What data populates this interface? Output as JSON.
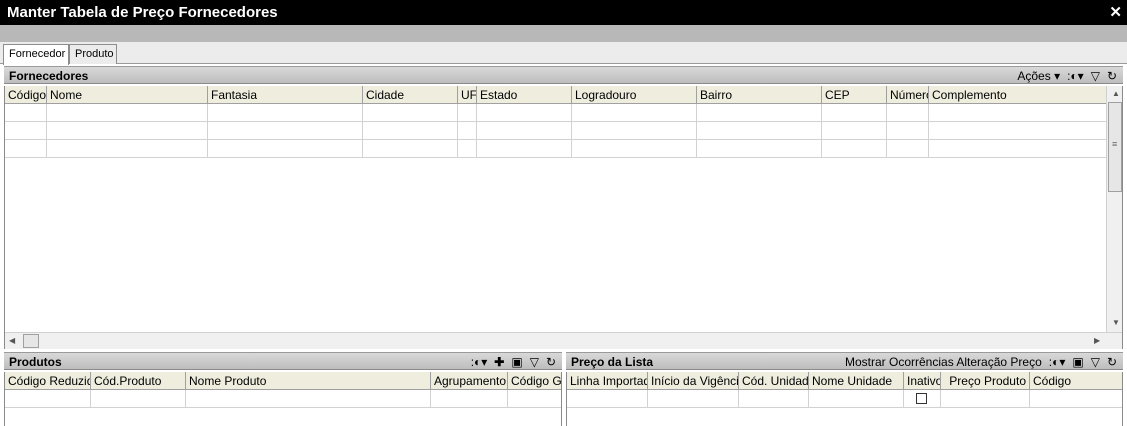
{
  "window": {
    "title": "Manter Tabela de Preço Fornecedores",
    "close_glyph": "✕"
  },
  "tabs": [
    {
      "label": "Fornecedor",
      "active": true
    },
    {
      "label": "Produto",
      "active": false
    }
  ],
  "fornecedores": {
    "title": "Fornecedores",
    "actions_label": "Ações",
    "icons": [
      "dropdown-icon",
      "view-options-icon",
      "filter-icon",
      "refresh-icon"
    ],
    "columns": [
      "Código",
      "Nome",
      "Fantasia",
      "Cidade",
      "UF",
      "Estado",
      "Logradouro",
      "Bairro",
      "CEP",
      "Número",
      "Complemento"
    ]
  },
  "produtos": {
    "title": "Produtos",
    "icons": [
      "view-options-icon",
      "add-icon",
      "export-icon",
      "filter-icon",
      "refresh-icon"
    ],
    "columns": [
      "Código Reduzido",
      "Cód.Produto",
      "Nome Produto",
      "Agrupamento",
      "Código Gru"
    ]
  },
  "preco_lista": {
    "title": "Preço da Lista",
    "show_occurrences_label": "Mostrar Ocorrências Alteração Preço",
    "icons": [
      "view-options-icon",
      "export-icon",
      "filter-icon",
      "refresh-icon"
    ],
    "columns": [
      "Linha Importada",
      "Início da Vigência",
      "Cód. Unidade",
      "Nome Unidade",
      "Inativo",
      "Preço Produto",
      "Código"
    ]
  },
  "colors": {
    "titlebar": "#000000",
    "header_bg": "#efedde",
    "panel_header": "#c9c9c9"
  }
}
